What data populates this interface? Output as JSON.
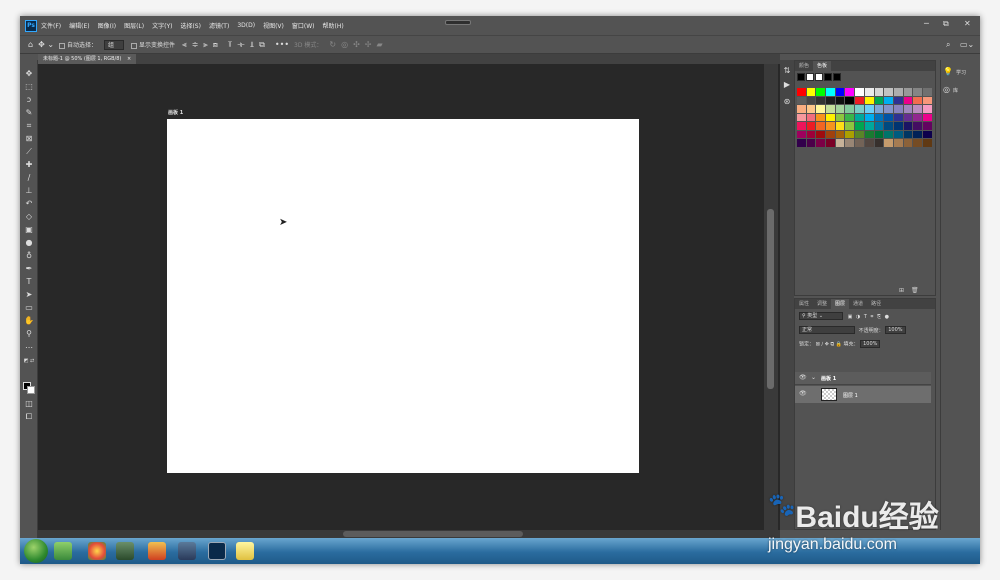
{
  "app": {
    "logo": "Ps"
  },
  "menu": [
    "文件(F)",
    "编辑(E)",
    "图像(I)",
    "图层(L)",
    "文字(Y)",
    "选择(S)",
    "滤镜(T)",
    "3D(D)",
    "视图(V)",
    "窗口(W)",
    "帮助(H)"
  ],
  "window_controls": {
    "minimize": "─",
    "restore": "⧉",
    "close": "✕"
  },
  "options": {
    "auto_select_label": "自动选择：",
    "auto_select_value": "组",
    "show_transform_label": "显示变换控件",
    "mode_3d_label": "3D 模式："
  },
  "document_tab": {
    "title": "未标题-1 @ 50% (图层 1, RGB/8)",
    "close": "×"
  },
  "artboard": {
    "label": "画板 1"
  },
  "swatches_panel": {
    "tabs": [
      "颜色",
      "色板"
    ],
    "active_tab": "色板",
    "recent": [
      "#000000",
      "#ffffff",
      "#ffffff",
      "#000000",
      "#000000"
    ],
    "colors": [
      "#ff0000",
      "#ffff00",
      "#00ff00",
      "#00ffff",
      "#0000ff",
      "#ff00ff",
      "#ffffff",
      "#ebebeb",
      "#d6d6d6",
      "#c2c2c2",
      "#adadad",
      "#999999",
      "#858585",
      "#707070",
      "#5c5c5c",
      "#474747",
      "#333333",
      "#1f1f1f",
      "#0f0f0f",
      "#000000",
      "#ed1c24",
      "#fff200",
      "#00a651",
      "#00aeef",
      "#2e3192",
      "#ec008c",
      "#f26c4f",
      "#f7977a",
      "#f9ad81",
      "#fdc68a",
      "#fff79a",
      "#c4df9b",
      "#a3d39c",
      "#82ca9d",
      "#7bcdc8",
      "#6ecff6",
      "#7ea7d8",
      "#8493ca",
      "#8882be",
      "#a187be",
      "#bc8dbf",
      "#f49ac2",
      "#f6989d",
      "#f26d7d",
      "#f7941d",
      "#fff200",
      "#8dc63f",
      "#39b54a",
      "#00a99d",
      "#00aeef",
      "#0072bc",
      "#0054a6",
      "#2e3192",
      "#662d91",
      "#92278f",
      "#ec008c",
      "#ed145b",
      "#ed1c24",
      "#f26522",
      "#f7941d",
      "#ffde17",
      "#8dc63f",
      "#00a651",
      "#00a99d",
      "#0076a3",
      "#004a80",
      "#003471",
      "#1b1464",
      "#440e62",
      "#630460",
      "#9e005d",
      "#9e0039",
      "#9e0b0f",
      "#a0410d",
      "#a36209",
      "#aba000",
      "#598527",
      "#197b30",
      "#007236",
      "#00746b",
      "#005b7f",
      "#003663",
      "#002157",
      "#0d004c",
      "#32004b",
      "#4b0049",
      "#7b0046",
      "#7a0026",
      "#c7b299",
      "#998675",
      "#736357",
      "#534741",
      "#37302d",
      "#c69c6d",
      "#a67c52",
      "#8c6239",
      "#754c24",
      "#603913"
    ]
  },
  "layers_panel": {
    "tabs": [
      "属性",
      "调整",
      "图层",
      "通道",
      "路径"
    ],
    "active_tab": "图层",
    "filter_label": "类型",
    "blend_mode": "正常",
    "opacity_label": "不透明度：",
    "opacity_value": "100%",
    "lock_label": "锁定：",
    "fill_label": "填充：",
    "fill_value": "100%",
    "layers": [
      {
        "name": "画板 1",
        "type": "artboard"
      },
      {
        "name": "图层 1",
        "type": "pixel"
      }
    ]
  },
  "right_panel": {
    "learn": "学习",
    "library": "库"
  },
  "watermark": {
    "line1": "Baidu经验",
    "line2": "jingyan.baidu.com"
  }
}
